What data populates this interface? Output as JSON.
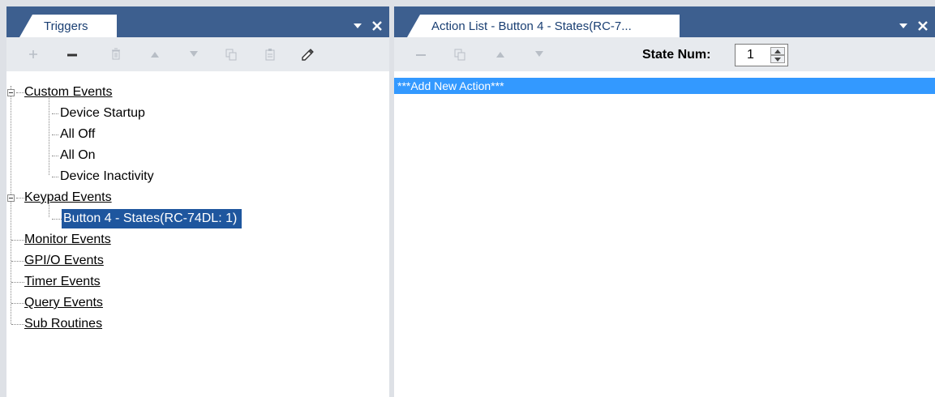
{
  "left_panel": {
    "tab_title": "Triggers",
    "toolbar_icons": [
      "add-icon",
      "remove-icon",
      "delete-icon",
      "move-up-icon",
      "move-down-icon",
      "copy-icon",
      "paste-icon",
      "edit-icon"
    ]
  },
  "tree": {
    "custom_events": {
      "label": "Custom Events",
      "children": [
        "Device Startup",
        "All Off",
        "All On",
        "Device Inactivity"
      ]
    },
    "keypad_events": {
      "label": "Keypad Events",
      "children": [
        "Button 4 - States(RC-74DL: 1)"
      ]
    },
    "monitor_events": "Monitor Events",
    "gpio_events": "GPI/O Events",
    "timer_events": "Timer Events",
    "query_events": "Query Events",
    "sub_routines": "Sub Routines"
  },
  "right_panel": {
    "tab_title": "Action List - Button 4 - States(RC-7...",
    "toolbar_icons": [
      "remove-icon",
      "copy-icon",
      "move-up-icon",
      "move-down-icon"
    ],
    "state_num_label": "State Num:",
    "state_num_value": "1",
    "actions": [
      "***Add New Action***"
    ]
  },
  "colors": {
    "panel_header": "#3d5f8f",
    "selection": "#1e569e",
    "action_highlight": "#3399ff"
  }
}
